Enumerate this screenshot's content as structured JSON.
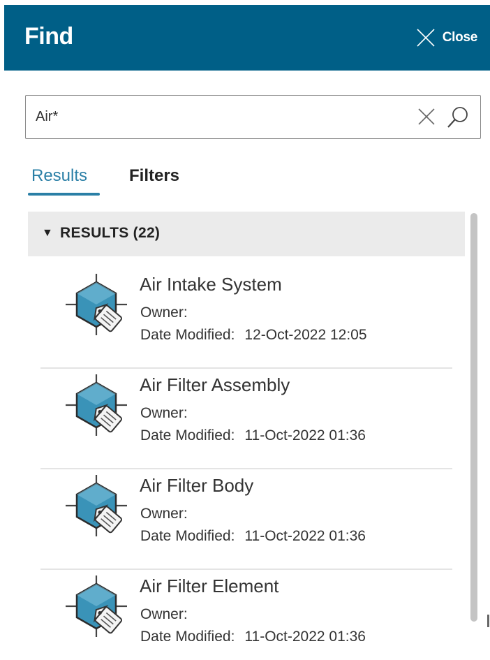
{
  "header": {
    "title": "Find",
    "close_label": "Close"
  },
  "search": {
    "value": "Air*",
    "placeholder": ""
  },
  "tabs": [
    {
      "label": "Results",
      "active": true
    },
    {
      "label": "Filters",
      "active": false
    }
  ],
  "results_section": {
    "title": "RESULTS (22)",
    "expanded": true
  },
  "results": [
    {
      "name": "Air Intake System",
      "owner_label": "Owner:",
      "owner": "",
      "date_label": "Date Modified:",
      "date": "12-Oct-2022 12:05"
    },
    {
      "name": "Air Filter Assembly",
      "owner_label": "Owner:",
      "owner": "",
      "date_label": "Date Modified:",
      "date": "11-Oct-2022 01:36"
    },
    {
      "name": "Air Filter Body",
      "owner_label": "Owner:",
      "owner": "",
      "date_label": "Date Modified:",
      "date": "11-Oct-2022 01:36"
    },
    {
      "name": "Air Filter Element",
      "owner_label": "Owner:",
      "owner": "",
      "date_label": "Date Modified:",
      "date": "11-Oct-2022 01:36"
    }
  ],
  "icons": {
    "close": "close-icon",
    "clear": "clear-icon",
    "search": "search-icon",
    "item": "tagged-part-icon",
    "caret": "caret-down-icon"
  },
  "colors": {
    "header": "#005f87",
    "accent": "#2a7fa6",
    "section_bg": "#ebebeb",
    "icon_fill": "#3a93b8"
  }
}
